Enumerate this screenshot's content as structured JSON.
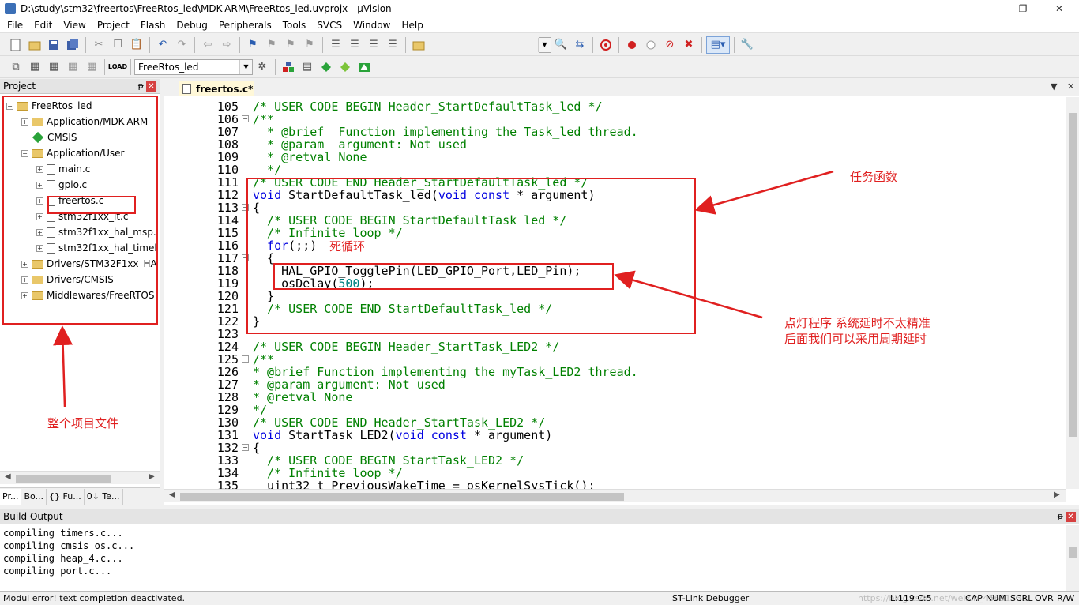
{
  "window": {
    "title": "D:\\study\\stm32\\freertos\\FreeRtos_led\\MDK-ARM\\FreeRtos_led.uvprojx - µVision",
    "min": "—",
    "max": "❐",
    "close": "✕"
  },
  "menu": [
    "File",
    "Edit",
    "View",
    "Project",
    "Flash",
    "Debug",
    "Peripherals",
    "Tools",
    "SVCS",
    "Window",
    "Help"
  ],
  "toolbar2": {
    "target": "FreeRtos_led"
  },
  "project_pane": {
    "title": "Project",
    "pin": "ᵽ",
    "close": "✕",
    "tree": [
      {
        "label": "FreeRtos_led",
        "exp": "−",
        "type": "root"
      },
      {
        "label": "Application/MDK-ARM",
        "exp": "+",
        "type": "folder"
      },
      {
        "label": "CMSIS",
        "exp": "",
        "type": "diamond"
      },
      {
        "label": "Application/User",
        "exp": "−",
        "type": "folder"
      },
      {
        "label": "main.c",
        "exp": "+",
        "type": "file"
      },
      {
        "label": "gpio.c",
        "exp": "+",
        "type": "file"
      },
      {
        "label": "freertos.c",
        "exp": "+",
        "type": "file"
      },
      {
        "label": "stm32f1xx_it.c",
        "exp": "+",
        "type": "file"
      },
      {
        "label": "stm32f1xx_hal_msp.",
        "exp": "+",
        "type": "file"
      },
      {
        "label": "stm32f1xx_hal_timel",
        "exp": "+",
        "type": "file"
      },
      {
        "label": "Drivers/STM32F1xx_HA",
        "exp": "+",
        "type": "folder"
      },
      {
        "label": "Drivers/CMSIS",
        "exp": "+",
        "type": "folder"
      },
      {
        "label": "Middlewares/FreeRTOS",
        "exp": "+",
        "type": "folder"
      }
    ],
    "tabs": [
      "Pr...",
      "Bo...",
      "{} Fu...",
      "0↓ Te..."
    ]
  },
  "editor": {
    "tab": "freertos.c*",
    "lines": [
      {
        "n": "105",
        "fold": "",
        "html": [
          [
            "cmt",
            "/* USER CODE BEGIN Header_StartDefaultTask_led */"
          ]
        ]
      },
      {
        "n": "106",
        "fold": "−",
        "html": [
          [
            "cmt",
            "/**"
          ]
        ]
      },
      {
        "n": "107",
        "fold": "",
        "html": [
          [
            "cmt",
            "  * @brief  Function implementing the Task_led thread."
          ]
        ]
      },
      {
        "n": "108",
        "fold": "",
        "html": [
          [
            "cmt",
            "  * @param  argument: Not used"
          ]
        ]
      },
      {
        "n": "109",
        "fold": "",
        "html": [
          [
            "cmt",
            "  * @retval None"
          ]
        ]
      },
      {
        "n": "110",
        "fold": "",
        "html": [
          [
            "cmt",
            "  */"
          ]
        ]
      },
      {
        "n": "111",
        "fold": "",
        "html": [
          [
            "cmt",
            "/* USER CODE END Header_StartDefaultTask_led */"
          ]
        ]
      },
      {
        "n": "112",
        "fold": "",
        "html": [
          [
            "kw",
            "void"
          ],
          [
            "",
            " StartDefaultTask_led("
          ],
          [
            "kw",
            "void const"
          ],
          [
            "",
            " * argument)"
          ]
        ]
      },
      {
        "n": "113",
        "fold": "−",
        "html": [
          [
            "",
            "{"
          ]
        ]
      },
      {
        "n": "114",
        "fold": "",
        "html": [
          [
            "cmt",
            "  /* USER CODE BEGIN StartDefaultTask_led */"
          ]
        ]
      },
      {
        "n": "115",
        "fold": "",
        "html": [
          [
            "cmt",
            "  /* Infinite loop */"
          ]
        ]
      },
      {
        "n": "116",
        "fold": "",
        "html": [
          [
            "kw",
            "  for"
          ],
          [
            "",
            "(;;)"
          ]
        ]
      },
      {
        "n": "117",
        "fold": "−",
        "html": [
          [
            "",
            "  {"
          ]
        ]
      },
      {
        "n": "118",
        "fold": "",
        "html": [
          [
            "",
            "    HAL_GPIO_TogglePin(LED_GPIO_Port,LED_Pin);"
          ]
        ]
      },
      {
        "n": "119",
        "fold": "",
        "html": [
          [
            "",
            "    osDelay("
          ],
          [
            "num",
            "500"
          ],
          [
            "",
            ");"
          ]
        ]
      },
      {
        "n": "120",
        "fold": "",
        "html": [
          [
            "",
            "  }"
          ]
        ]
      },
      {
        "n": "121",
        "fold": "",
        "html": [
          [
            "cmt",
            "  /* USER CODE END StartDefaultTask_led */"
          ]
        ]
      },
      {
        "n": "122",
        "fold": "",
        "html": [
          [
            "",
            "}"
          ]
        ]
      },
      {
        "n": "123",
        "fold": "",
        "html": [
          [
            "",
            ""
          ]
        ]
      },
      {
        "n": "124",
        "fold": "",
        "html": [
          [
            "cmt",
            "/* USER CODE BEGIN Header_StartTask_LED2 */"
          ]
        ]
      },
      {
        "n": "125",
        "fold": "−",
        "html": [
          [
            "cmt",
            "/**"
          ]
        ]
      },
      {
        "n": "126",
        "fold": "",
        "html": [
          [
            "cmt",
            "* @brief Function implementing the myTask_LED2 thread."
          ]
        ]
      },
      {
        "n": "127",
        "fold": "",
        "html": [
          [
            "cmt",
            "* @param argument: Not used"
          ]
        ]
      },
      {
        "n": "128",
        "fold": "",
        "html": [
          [
            "cmt",
            "* @retval None"
          ]
        ]
      },
      {
        "n": "129",
        "fold": "",
        "html": [
          [
            "cmt",
            "*/"
          ]
        ]
      },
      {
        "n": "130",
        "fold": "",
        "html": [
          [
            "cmt",
            "/* USER CODE END Header_StartTask_LED2 */"
          ]
        ]
      },
      {
        "n": "131",
        "fold": "",
        "html": [
          [
            "kw",
            "void"
          ],
          [
            "",
            " StartTask_LED2("
          ],
          [
            "kw",
            "void const"
          ],
          [
            "",
            " * argument)"
          ]
        ]
      },
      {
        "n": "132",
        "fold": "−",
        "html": [
          [
            "",
            "{"
          ]
        ]
      },
      {
        "n": "133",
        "fold": "",
        "html": [
          [
            "cmt",
            "  /* USER CODE BEGIN StartTask_LED2 */"
          ]
        ]
      },
      {
        "n": "134",
        "fold": "",
        "html": [
          [
            "cmt",
            "  /* Infinite loop */"
          ]
        ]
      },
      {
        "n": "135",
        "fold": "",
        "html": [
          [
            "",
            "  uint32_t PreviousWakeTime = osKernelSysTick();"
          ]
        ]
      }
    ]
  },
  "annotations": {
    "task_func": "任务函数",
    "dead_loop": "死循环",
    "led_line1": "点灯程序  系统延时不太精准",
    "led_line2": "后面我们可以采用周期延时",
    "project_files": "整个项目文件"
  },
  "build": {
    "title": "Build Output",
    "pin": "ᵽ",
    "close": "✕",
    "lines": [
      "compiling timers.c...",
      "compiling cmsis_os.c...",
      "compiling heap_4.c...",
      "compiling port.c..."
    ]
  },
  "status": {
    "message": "Modul error! text completion deactivated.",
    "debugger": "ST-Link Debugger",
    "watermark": "https://blog.csdn.net/weixin_45651738",
    "cursor": "L:119 C:5",
    "caps": "CAP",
    "num": "NUM",
    "scrl": "SCRL",
    "ovr": "OVR",
    "rw": "R/W"
  }
}
